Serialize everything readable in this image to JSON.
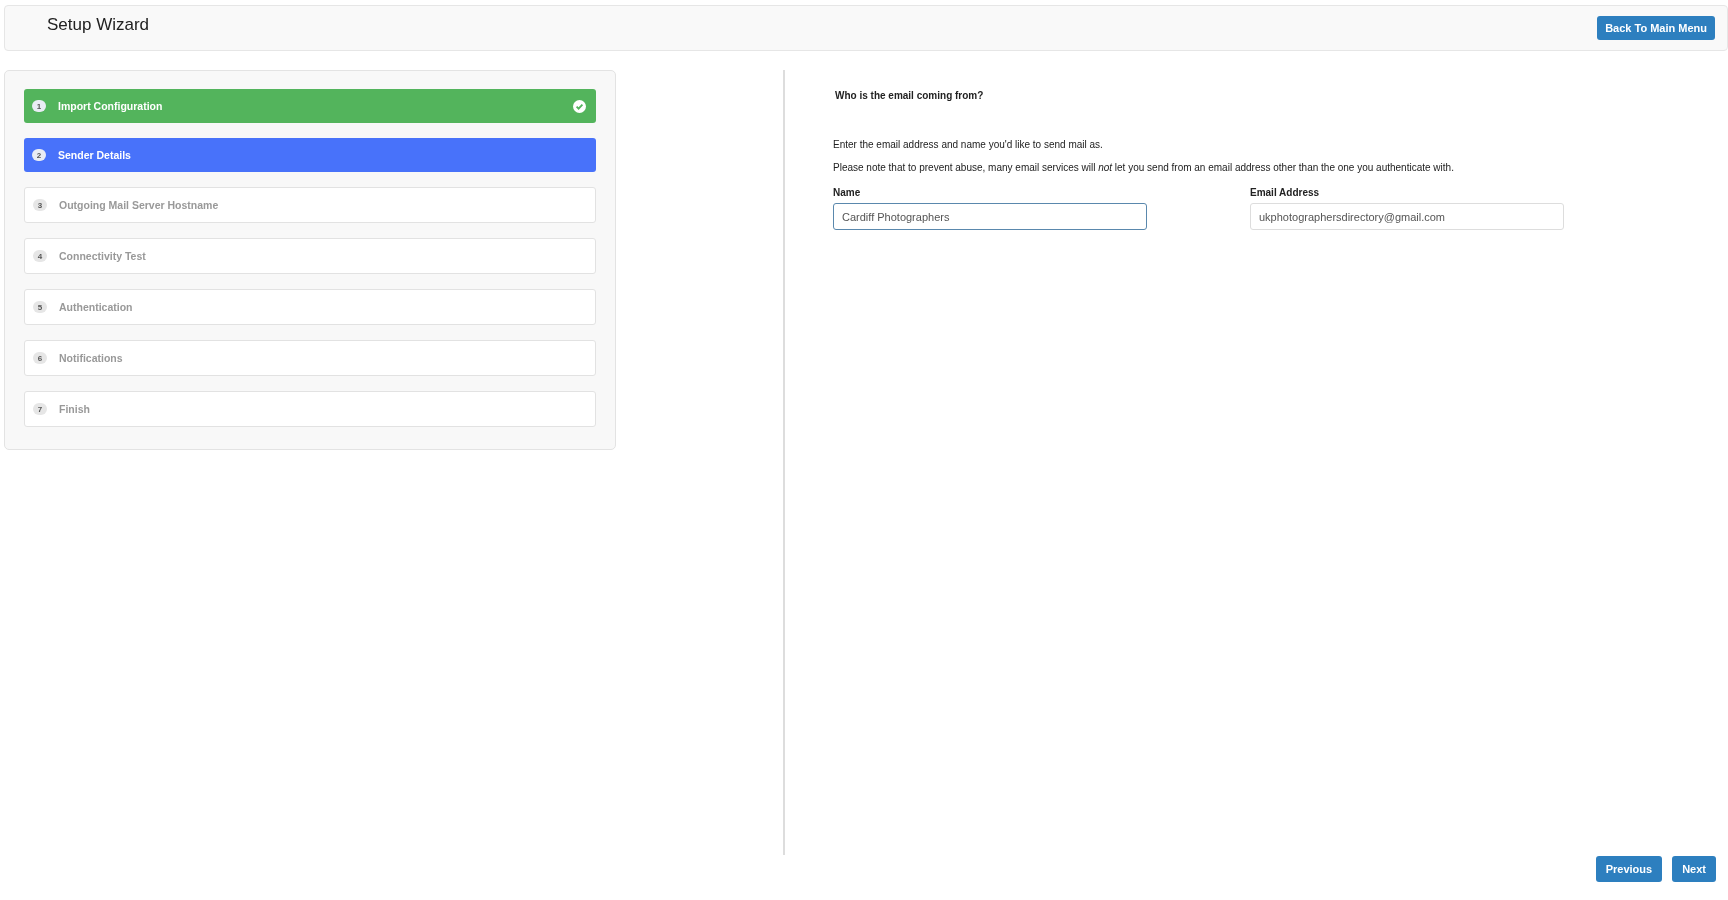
{
  "header": {
    "title": "Setup Wizard",
    "back_button": "Back To Main Menu"
  },
  "steps": [
    {
      "number": "1",
      "label": "Import Configuration",
      "completed": true,
      "selected": false
    },
    {
      "number": "2",
      "label": "Sender Details",
      "completed": false,
      "selected": true
    },
    {
      "number": "3",
      "label": "Outgoing Mail Server Hostname",
      "completed": false,
      "selected": false
    },
    {
      "number": "4",
      "label": "Connectivity Test",
      "completed": false,
      "selected": false
    },
    {
      "number": "5",
      "label": "Authentication",
      "completed": false,
      "selected": false
    },
    {
      "number": "6",
      "label": "Notifications",
      "completed": false,
      "selected": false
    },
    {
      "number": "7",
      "label": "Finish",
      "completed": false,
      "selected": false
    }
  ],
  "form": {
    "heading": "Who is the email coming from?",
    "intro": "Enter the email address and name you'd like to send mail as.",
    "note": "Please note that to prevent abuse, many email services will *not* let you send from an email address other than the one you authenticate with.",
    "fields": [
      {
        "label": "Name",
        "value": "Cardiff Photographers",
        "focused": true
      },
      {
        "label": "Email Address",
        "value": "ukphotographersdirectory@gmail.com",
        "focused": false
      }
    ]
  },
  "buttons": [
    "Previous",
    "Next"
  ]
}
